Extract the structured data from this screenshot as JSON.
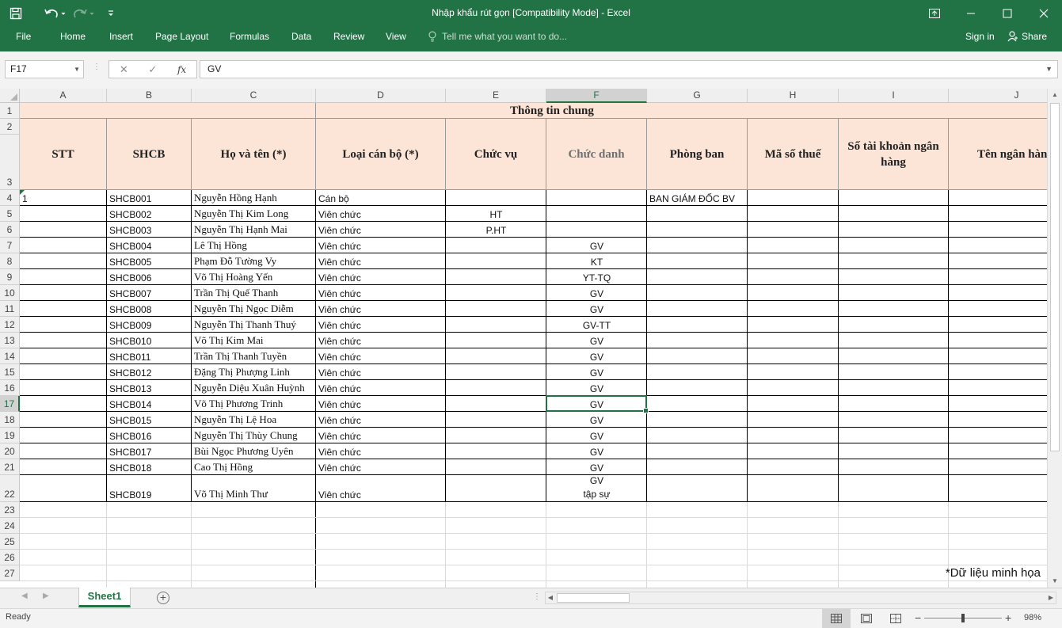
{
  "window": {
    "title": "Nhập khẩu rút gọn  [Compatibility Mode] - Excel"
  },
  "ribbon": {
    "tabs": [
      "File",
      "Home",
      "Insert",
      "Page Layout",
      "Formulas",
      "Data",
      "Review",
      "View"
    ],
    "tell_me": "Tell me what you want to do...",
    "sign_in": "Sign in",
    "share": "Share"
  },
  "formula_bar": {
    "name_box": "F17",
    "fx": "fx",
    "formula": "GV"
  },
  "columns": [
    "A",
    "B",
    "C",
    "D",
    "E",
    "F",
    "G",
    "H",
    "I",
    "J"
  ],
  "selected_column": "F",
  "selected_row": "17",
  "row_numbers": [
    "1",
    "2",
    "3",
    "4",
    "5",
    "6",
    "7",
    "8",
    "9",
    "10",
    "11",
    "12",
    "13",
    "14",
    "15",
    "16",
    "17",
    "18",
    "19",
    "20",
    "21",
    "22",
    "23",
    "24",
    "25",
    "26",
    "27"
  ],
  "sheet": {
    "group_header": "Thông tin chung",
    "headers": [
      "STT",
      "SHCB",
      "Họ và tên (*)",
      "Loại cán bộ (*)",
      "Chức vụ",
      "Chức danh",
      "Phòng ban",
      "Mã số thuế",
      "Số tài khoản ngân hàng",
      "Tên ngân hàng"
    ],
    "rows": [
      {
        "stt": "1",
        "shcb": "SHCB001",
        "name": "Nguyễn Hồng Hạnh",
        "type": "Cán bộ",
        "position": "",
        "title": "",
        "dept": "BAN GIÁM ĐỐC BV"
      },
      {
        "stt": "",
        "shcb": "SHCB002",
        "name": "Nguyễn Thị Kim Long",
        "type": "Viên chức",
        "position": "HT",
        "title": "",
        "dept": ""
      },
      {
        "stt": "",
        "shcb": "SHCB003",
        "name": "Nguyễn Thị Hạnh Mai",
        "type": "Viên chức",
        "position": "P.HT",
        "title": "",
        "dept": ""
      },
      {
        "stt": "",
        "shcb": "SHCB004",
        "name": "Lê Thị Hồng",
        "type": "Viên chức",
        "position": "",
        "title": "GV",
        "dept": ""
      },
      {
        "stt": "",
        "shcb": "SHCB005",
        "name": "Phạm Đỗ Tường Vy",
        "type": "Viên chức",
        "position": "",
        "title": "KT",
        "dept": ""
      },
      {
        "stt": "",
        "shcb": "SHCB006",
        "name": "Võ Thị Hoàng Yến",
        "type": "Viên chức",
        "position": "",
        "title": "YT-TQ",
        "dept": ""
      },
      {
        "stt": "",
        "shcb": "SHCB007",
        "name": "Trần Thị Quế Thanh",
        "type": "Viên chức",
        "position": "",
        "title": "GV",
        "dept": ""
      },
      {
        "stt": "",
        "shcb": "SHCB008",
        "name": "Nguyễn Thị Ngọc Diễm",
        "type": "Viên chức",
        "position": "",
        "title": "GV",
        "dept": ""
      },
      {
        "stt": "",
        "shcb": "SHCB009",
        "name": "Nguyễn Thị Thanh Thuý",
        "type": "Viên chức",
        "position": "",
        "title": "GV-TT",
        "dept": ""
      },
      {
        "stt": "",
        "shcb": "SHCB010",
        "name": "Võ Thị Kim Mai",
        "type": "Viên chức",
        "position": "",
        "title": "GV",
        "dept": ""
      },
      {
        "stt": "",
        "shcb": "SHCB011",
        "name": "Trần Thị Thanh Tuyền",
        "type": "Viên chức",
        "position": "",
        "title": "GV",
        "dept": ""
      },
      {
        "stt": "",
        "shcb": "SHCB012",
        "name": "Đặng Thị Phượng Linh",
        "type": "Viên chức",
        "position": "",
        "title": "GV",
        "dept": ""
      },
      {
        "stt": "",
        "shcb": "SHCB013",
        "name": "Nguyễn Diệu Xuân Huỳnh",
        "type": "Viên chức",
        "position": "",
        "title": "GV",
        "dept": ""
      },
      {
        "stt": "",
        "shcb": "SHCB014",
        "name": "Võ Thị Phương Trinh",
        "type": "Viên chức",
        "position": "",
        "title": "GV",
        "dept": ""
      },
      {
        "stt": "",
        "shcb": "SHCB015",
        "name": "Nguyễn Thị Lệ Hoa",
        "type": "Viên chức",
        "position": "",
        "title": "GV",
        "dept": ""
      },
      {
        "stt": "",
        "shcb": "SHCB016",
        "name": "Nguyễn Thị Thùy Chung",
        "type": "Viên chức",
        "position": "",
        "title": "GV",
        "dept": ""
      },
      {
        "stt": "",
        "shcb": "SHCB017",
        "name": "Bùi Ngọc Phương Uyên",
        "type": "Viên chức",
        "position": "",
        "title": "GV",
        "dept": ""
      },
      {
        "stt": "",
        "shcb": "SHCB018",
        "name": "Cao Thị Hồng",
        "type": "Viên chức",
        "position": "",
        "title": "GV",
        "dept": ""
      },
      {
        "stt": "",
        "shcb": "SHCB019",
        "name": "Võ Thị Minh Thư",
        "type": "Viên chức",
        "position": "",
        "title": "GV\ntập sự",
        "dept": ""
      }
    ],
    "footnote": "*Dữ liệu minh họa"
  },
  "sheet_tabs": {
    "active": "Sheet1"
  },
  "status_bar": {
    "status": "Ready",
    "zoom": "98%"
  },
  "colors": {
    "accent": "#217346",
    "header_fill": "#fce4d6"
  }
}
